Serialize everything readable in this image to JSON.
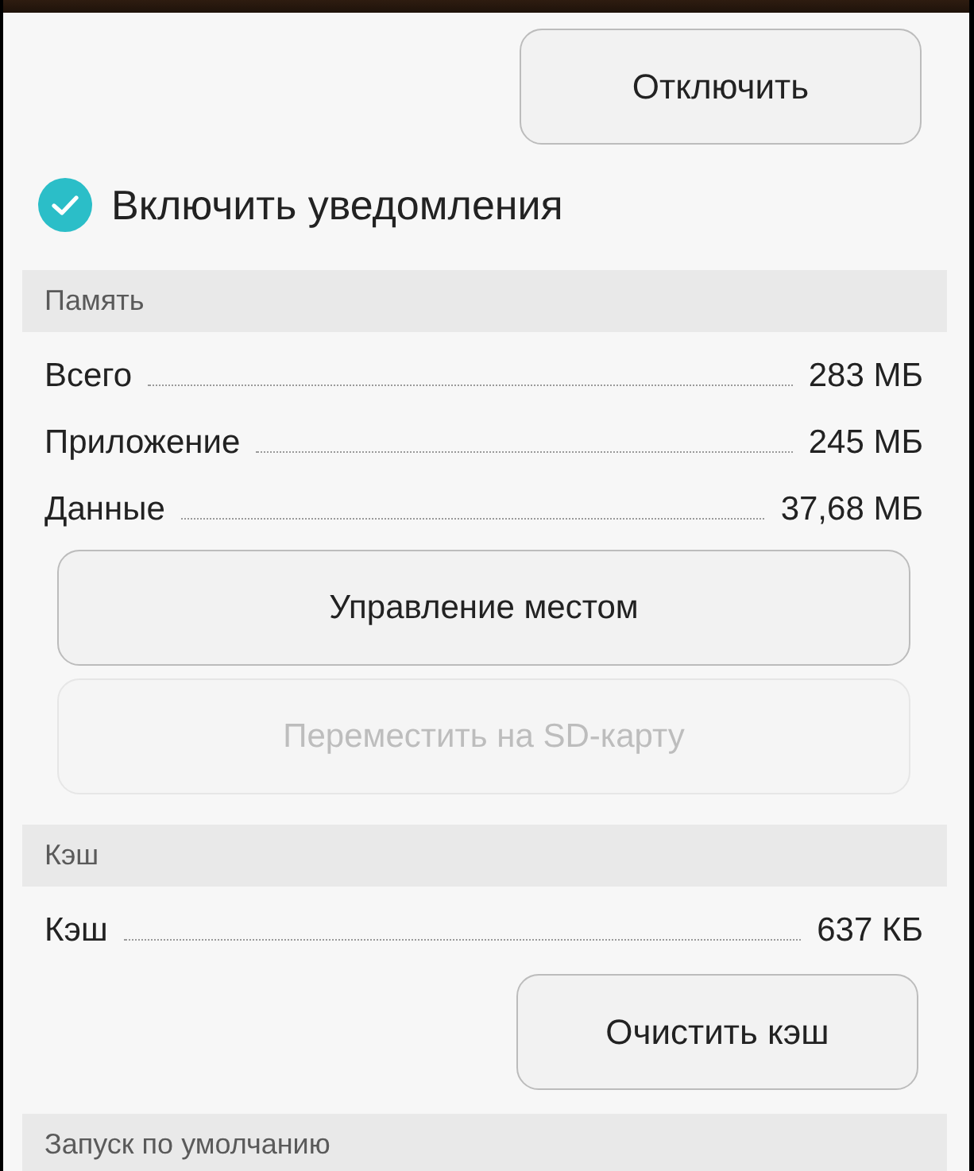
{
  "header_button": {
    "label": "Отключить",
    "disabled": false
  },
  "notifications": {
    "label": "Включить уведомления",
    "checked": true
  },
  "sections": [
    {
      "title": "Память",
      "items": [
        {
          "kind": "row",
          "label": "Всего",
          "value": "283 МБ"
        },
        {
          "kind": "row",
          "label": "Приложение",
          "value": "245 МБ"
        },
        {
          "kind": "row",
          "label": "Данные",
          "value": "37,68 МБ"
        },
        {
          "kind": "wide_button",
          "label": "Управление местом",
          "disabled": false
        },
        {
          "kind": "wide_button",
          "label": "Переместить на SD-карту",
          "disabled": true
        }
      ]
    },
    {
      "title": "Кэш",
      "items": [
        {
          "kind": "row",
          "label": "Кэш",
          "value": "637 КБ"
        },
        {
          "kind": "side_button",
          "label": "Очистить кэш",
          "disabled": false
        }
      ]
    },
    {
      "title": "Запуск по умолчанию"
    }
  ]
}
